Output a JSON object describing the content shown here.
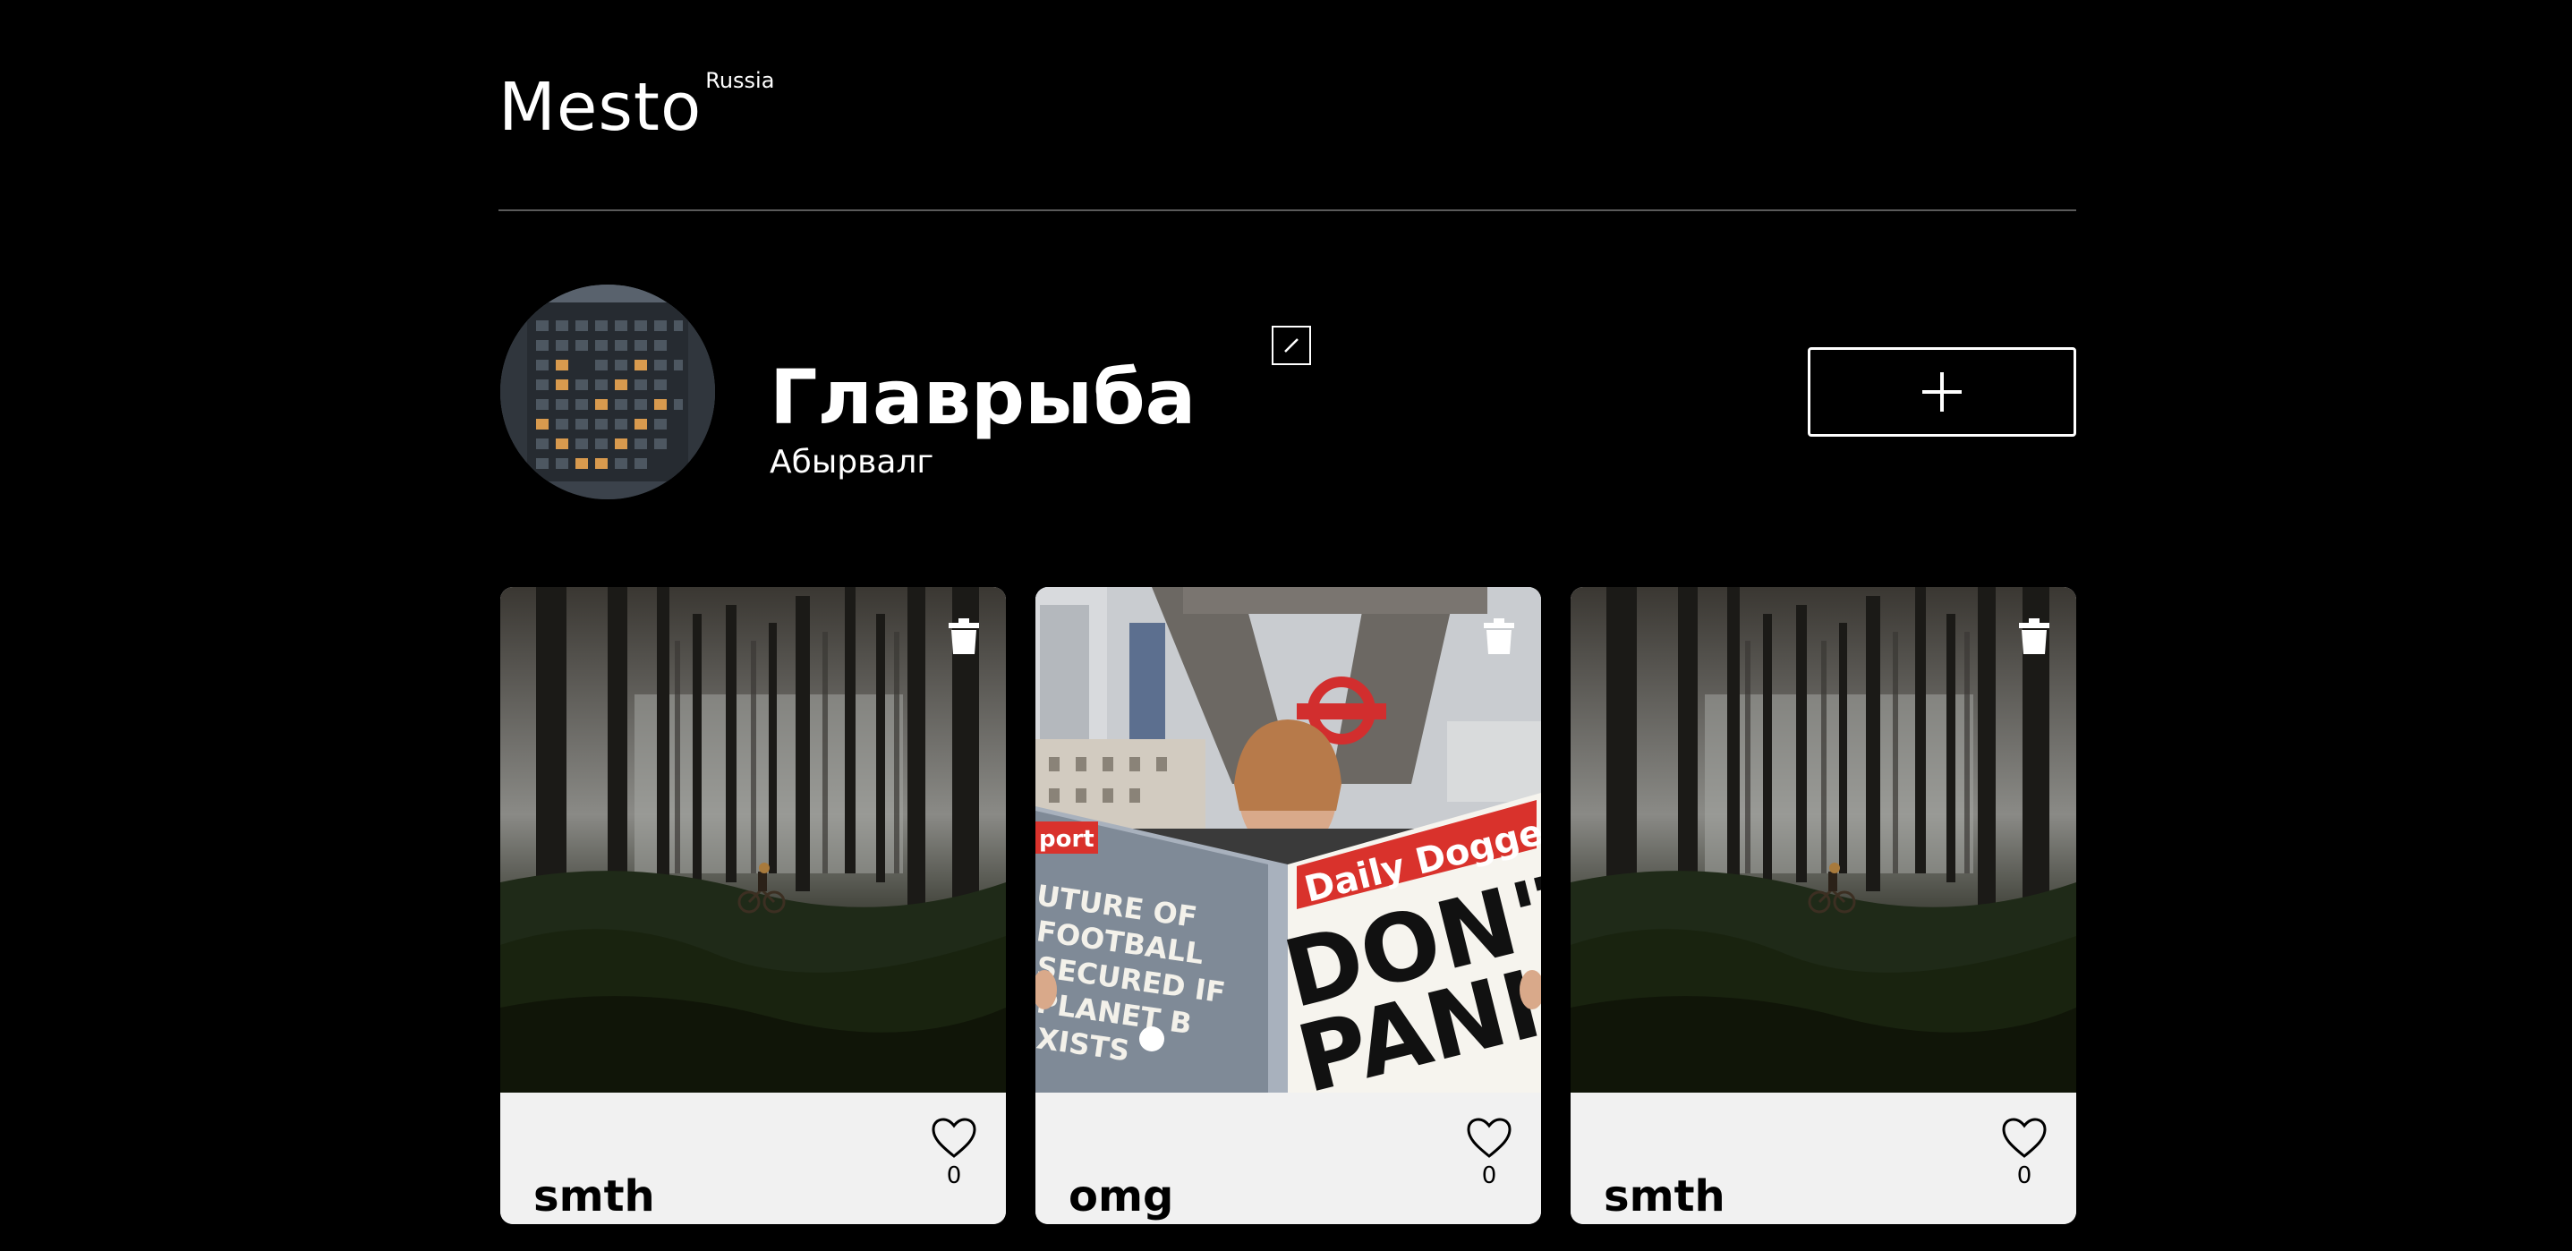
{
  "header": {
    "logo_main": "Mesto",
    "logo_sup": "Russia"
  },
  "profile": {
    "name": "Главрыба",
    "about": "Абырвалг",
    "edit_icon": "pencil-icon",
    "add_icon": "plus-icon"
  },
  "cards": [
    {
      "title": "smth",
      "likes": "0",
      "image": "forest-cyclist-photo"
    },
    {
      "title": "omg",
      "likes": "0",
      "image": "newspaper-reader-photo"
    },
    {
      "title": "smth",
      "likes": "0",
      "image": "forest-cyclist-photo"
    }
  ],
  "colors": {
    "background": "#000000",
    "card_footer": "#f1f1f1",
    "divider": "#5a5a5a",
    "text_primary": "#ffffff",
    "text_card": "#000000"
  }
}
